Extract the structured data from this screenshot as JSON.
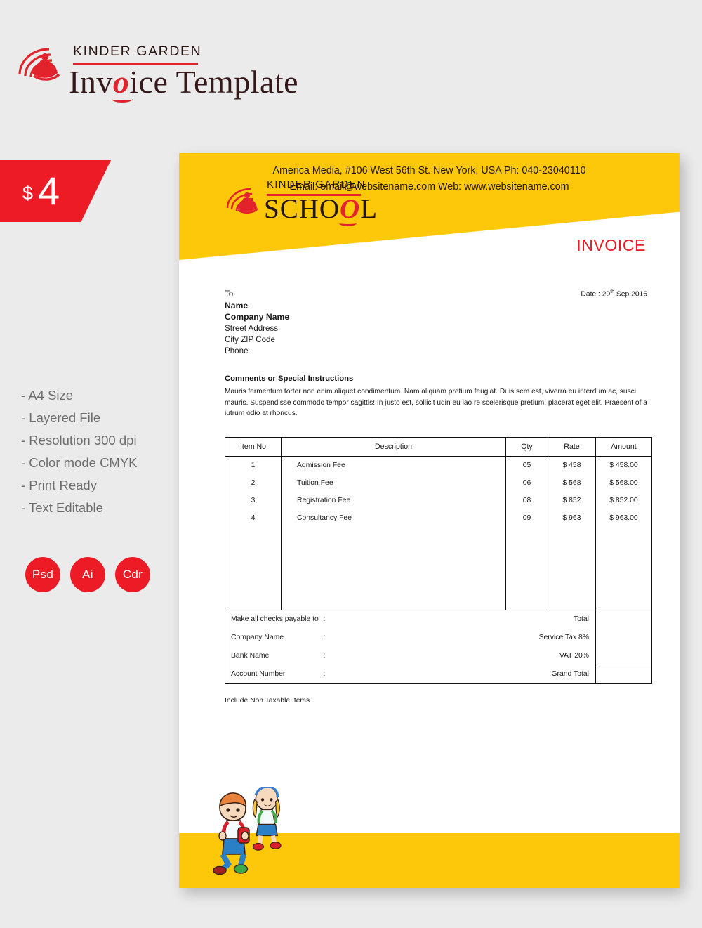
{
  "promo": {
    "logo": {
      "kindergarden": "KINDER GARDEN",
      "title_before": "Inv",
      "title_o": "o",
      "title_after": "ice Template"
    },
    "price": {
      "currency": "$",
      "amount": "4"
    },
    "features": [
      "- A4 Size",
      "- Layered File",
      "- Resolution 300 dpi",
      "- Color mode CMYK",
      "- Print Ready",
      "- Text Editable"
    ],
    "badges": [
      "Psd",
      "Ai",
      "Cdr"
    ]
  },
  "invoice": {
    "logo": {
      "kindergarden": "KINDER GARDEN",
      "school_before": "SCHO",
      "school_o": "O",
      "school_after": "L"
    },
    "heading": "INVOICE",
    "date_label": "Date : 29",
    "date_sup": "th",
    "date_rest": " Sep 2016",
    "to": {
      "to_label": "To",
      "name": "Name",
      "company": "Company Name",
      "street": "Street Address",
      "city_zip": "City ZIP Code",
      "phone": "Phone"
    },
    "comments": {
      "title": "Comments or Special Instructions",
      "body": "Mauris fermentum tortor non enim aliquet condimentum. Nam aliquam pretium feugiat. Duis sem est, viverra eu interdum ac, susci mauris. Suspendisse commodo tempor sagittis! In justo est, sollicit udin eu  lao re scelerisque pretium, placerat eget elit. Praesent of a iutrum odio at rhoncus."
    },
    "table": {
      "headers": [
        "Item No",
        "Description",
        "Qty",
        "Rate",
        "Amount"
      ],
      "rows": [
        {
          "item": "1",
          "desc": "Admission Fee",
          "qty": "05",
          "rate": "$ 458",
          "amount": "$ 458.00"
        },
        {
          "item": "2",
          "desc": "Tuition Fee",
          "qty": "06",
          "rate": "$ 568",
          "amount": "$ 568.00"
        },
        {
          "item": "3",
          "desc": "Registration Fee",
          "qty": "08",
          "rate": "$ 852",
          "amount": "$ 852.00"
        },
        {
          "item": "4",
          "desc": "Consultancy Fee",
          "qty": "09",
          "rate": "$ 963",
          "amount": "$ 963.00"
        }
      ]
    },
    "payment": {
      "rows": [
        {
          "label": "Make all checks payable to",
          "colon": ":",
          "value": ""
        },
        {
          "label": "Company Name",
          "colon": ":",
          "value": ""
        },
        {
          "label": "Bank Name",
          "colon": ":",
          "value": ""
        },
        {
          "label": "Account Number",
          "colon": ":",
          "value": ""
        }
      ]
    },
    "totals": {
      "rows": [
        {
          "label": "Total",
          "value": ""
        },
        {
          "label": "Service Tax 8%",
          "value": ""
        },
        {
          "label": "VAT 20%",
          "value": ""
        },
        {
          "label": "Grand Total",
          "value": ""
        }
      ]
    },
    "non_taxable": "Include Non Taxable Items",
    "footer": {
      "line1": "America Media, #106 West 56th St. New York, USA Ph: 040-23040110",
      "line2": "Email: email@websitename.com Web: www.websitename.com"
    }
  },
  "colors": {
    "red": "#ed1b26",
    "yellow": "#fdc809",
    "background": "#ebebeb",
    "text_dark": "#231815"
  }
}
